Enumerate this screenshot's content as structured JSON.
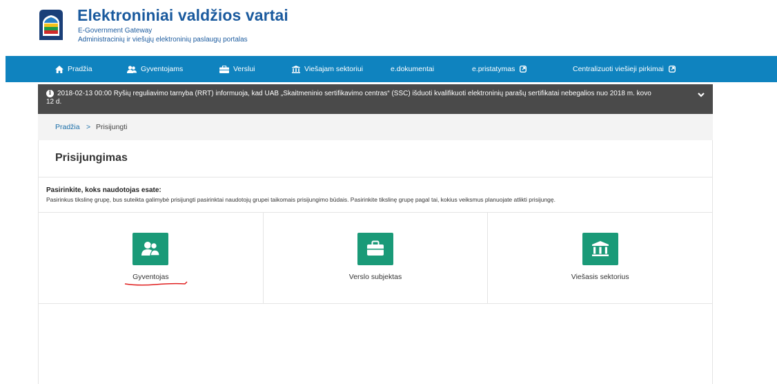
{
  "header": {
    "title": "Elektroniniai valdžios vartai",
    "subtitle": "E-Government Gateway",
    "tagline": "Administracinių ir viešųjų elektroninių paslaugų portalas"
  },
  "nav": {
    "items": [
      {
        "label": "Pradžia",
        "icon": "home-icon"
      },
      {
        "label": "Gyventojams",
        "icon": "users-icon"
      },
      {
        "label": "Verslui",
        "icon": "briefcase-icon"
      },
      {
        "label": "Viešajam sektoriui",
        "icon": "institution-icon"
      },
      {
        "label": "e.dokumentai"
      },
      {
        "label": "e.pristatymas",
        "icon": "external-link-icon"
      },
      {
        "label": "Centralizuoti viešieji pirkimai",
        "icon": "external-link-icon"
      }
    ]
  },
  "alert": {
    "text": "2018-02-13 00:00   Ryšių reguliavimo tarnyba (RRT) informuoja, kad UAB „Skaitmeninio sertifikavimo centras“ (SSC) išduoti kvalifikuoti elektroninių parašų sertifikatai nebegalios nuo 2018 m. kovo 12 d."
  },
  "breadcrumb": {
    "home": "Pradžia",
    "separator": ">",
    "current": "Prisijungti"
  },
  "page": {
    "title": "Prisijungimas",
    "instruction_heading": "Pasirinkite, koks naudotojas esate:",
    "instruction_text": "Pasirinkus tikslinę grupę, bus suteikta galimybė prisijungti pasirinktai naudotojų grupei taikomais prisijungimo būdais. Pasirinkite tikslinę grupę pagal tai, kokius veiksmus planuojate atlikti prisijungę."
  },
  "options": [
    {
      "label": "Gyventojas",
      "icon": "users-icon"
    },
    {
      "label": "Verslo subjektas",
      "icon": "briefcase-icon"
    },
    {
      "label": "Viešasis sektorius",
      "icon": "institution-icon"
    }
  ],
  "colors": {
    "brand_blue": "#1a5a9e",
    "nav_bg": "#0f83bf",
    "alert_bg": "#4a4a4a",
    "option_green": "#1a9a78",
    "annotation_red": "#e02020"
  }
}
